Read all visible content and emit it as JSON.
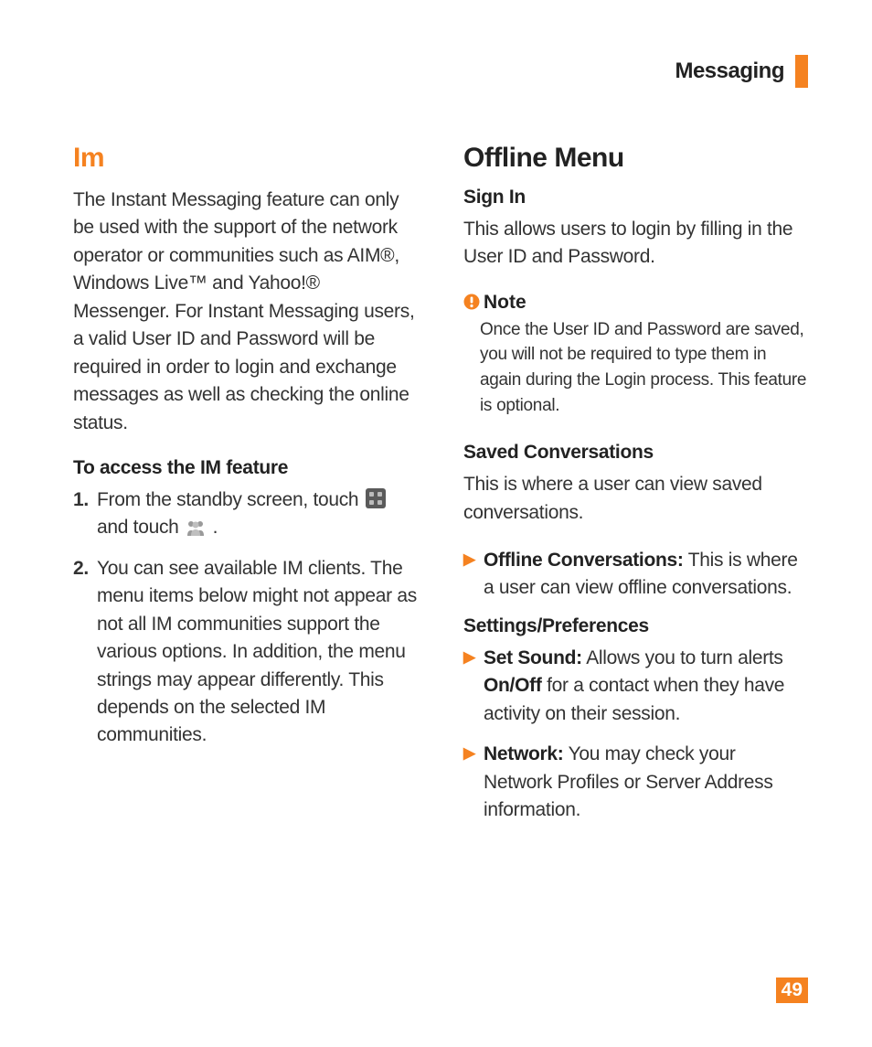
{
  "header": {
    "section_title": "Messaging"
  },
  "page_number": "49",
  "left": {
    "title": "Im",
    "intro": "The Instant Messaging feature can only be used with the support of the network operator or communities such as AIM®, Windows Live™ and Yahoo!® Messenger. For Instant Messaging users, a valid User ID and Password will be required in order to login and exchange messages as well as checking the online status.",
    "access_heading": "To access the IM feature",
    "steps": [
      {
        "num": "1.",
        "pre": "From the standby screen, touch ",
        "mid": " and touch ",
        "post": " ."
      },
      {
        "num": "2.",
        "text": "You can see available IM clients. The menu items below might not appear as not all IM communities support the various options. In addition, the menu strings may appear differently. This depends on the selected IM communities."
      }
    ]
  },
  "right": {
    "title": "Offline Menu",
    "sign_in": {
      "heading": "Sign In",
      "text": "This allows users to login by filling in the User ID and Password."
    },
    "note": {
      "label": "Note",
      "body": "Once the User ID and Password are saved, you will not be required to type them in again during the Login process. This feature is optional."
    },
    "saved": {
      "heading": "Saved Conversations",
      "text": "This is where a user can view saved conversations."
    },
    "offline_conv": {
      "label": "Offline Conversations:",
      "text": " This is where a user can view offline conversations."
    },
    "settings_heading": "Settings/Preferences",
    "set_sound": {
      "label": "Set Sound:",
      "pre": " Allows you to turn alerts ",
      "bold": "On/Off",
      "post": " for a contact when they have activity on their session."
    },
    "network": {
      "label": "Network:",
      "text": " You may check your Network Profiles or Server Address information."
    }
  }
}
